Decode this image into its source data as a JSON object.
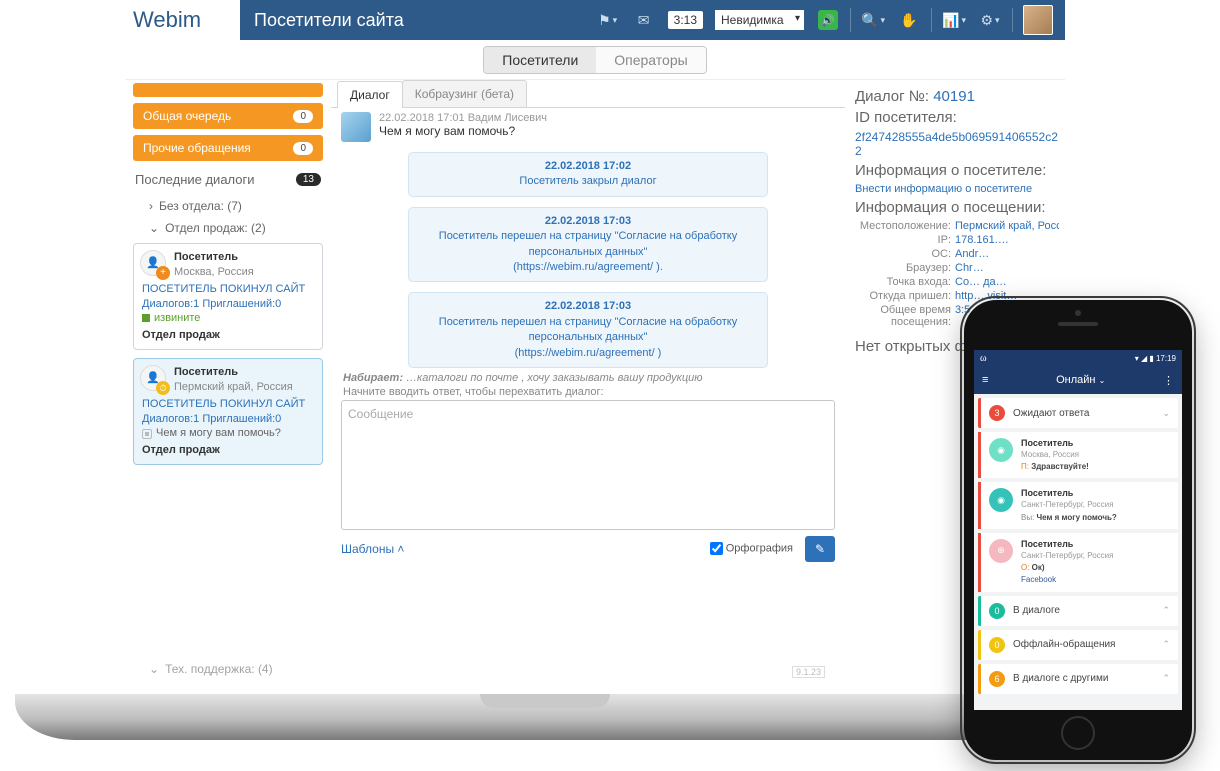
{
  "header": {
    "logo": "Webim",
    "title": "Посетители сайта",
    "timer": "3:13",
    "status_selected": "Невидимка"
  },
  "topseg": {
    "visitors": "Посетители",
    "operators": "Операторы"
  },
  "sidebar": {
    "pill_mine": "",
    "pill_queue": "Общая очередь",
    "pill_queue_badge": "0",
    "pill_other": "Прочие обращения",
    "pill_other_badge": "0",
    "recent_title": "Последние диалоги",
    "recent_badge": "13",
    "dept_none": "Без отдела: (7)",
    "dept_sales": "Отдел продаж: (2)",
    "dept_support": "Тех. поддержка: (4)",
    "card1": {
      "who": "Посетитель",
      "loc": "Москва, Россия",
      "state": "ПОСЕТИТЕЛЬ ПОКИНУЛ САЙТ",
      "stats": "Диалогов:1 Приглашений:0",
      "msg": "извините",
      "dept": "Отдел продаж"
    },
    "card2": {
      "who": "Посетитель",
      "loc": "Пермский край, Россия",
      "state": "ПОСЕТИТЕЛЬ ПОКИНУЛ САЙТ",
      "stats": "Диалогов:1 Приглашений:0",
      "msg": "Чем я могу вам помочь?",
      "dept": "Отдел продаж"
    }
  },
  "chat": {
    "tab_dialog": "Диалог",
    "tab_cobrowse": "Кобраузинг (бета)",
    "op_head": "22.02.2018 17:01   Вадим Лисевич",
    "op_text": "Чем я могу вам помочь?",
    "sys1_ts": "22.02.2018 17:02",
    "sys1_txt": "Посетитель закрыл диалог",
    "sys2_ts": "22.02.2018 17:03",
    "sys2_txt": "Посетитель перешел на страницу \"Согласие на обработку персональных данных\"",
    "sys2_url": "(https://webim.ru/agreement/ ).",
    "sys3_ts": "22.02.2018 17:03",
    "sys3_txt": "Посетитель перешел на страницу \"Согласие на обработку персональных данных\"",
    "sys3_url": "(https://webim.ru/agreement/ )",
    "typing_label": "Набирает:",
    "typing_text": " …каталоги по почте , хочу заказывать вашу продукцию",
    "hint": "Начните вводить ответ, чтобы перехватить диалог:",
    "placeholder": "Сообщение",
    "templates": "Шаблоны",
    "spell": "Орфография",
    "version": "9.1.23"
  },
  "info": {
    "dlg_label": "Диалог №: ",
    "dlg_id": "40191",
    "visitor_label": "ID посетителя:",
    "visitor_id": "2f247428555a4de5b069591406552c22",
    "about_visitor": "Информация о посетителе:",
    "enter_info": "Внести информацию о посетителе",
    "about_visit": "Информация о посещении:",
    "k_loc": "Местоположение:",
    "v_loc": "Пермский край, Россия",
    "k_ip": "IP:",
    "v_ip": "178.161.…",
    "k_os": "ОС:",
    "v_os": "Andr…",
    "k_browser": "Браузер:",
    "v_browser": "Chr…",
    "k_entry": "Точка входа:",
    "v_entry": "Со… да…",
    "k_ref": "Откуда пришел:",
    "v_ref": "http… visit…",
    "k_time": "Общее время посещения:",
    "v_time": "3:5…",
    "no_open": "Нет открытых ф…"
  },
  "phone": {
    "time": "17:19",
    "title": "Онлайн",
    "sec_wait": "Ожидают ответа",
    "sec_wait_n": "3",
    "sec_dlg": "В диалоге",
    "sec_dlg_n": "0",
    "sec_off": "Оффлайн-обращения",
    "sec_off_n": "0",
    "sec_other": "В диалоге с другими",
    "sec_other_n": "6",
    "c1_name": "Посетитель",
    "c1_loc": "Москва, Россия",
    "c1_pre": "П:",
    "c1_msg": " Здравствуйте!",
    "c2_name": "Посетитель",
    "c2_loc": "Санкт-Петербург, Россия",
    "c2_pre": "Вы:",
    "c2_msg": " Чем я могу помочь?",
    "c3_name": "Посетитель",
    "c3_loc": "Санкт-Петербург, Россия",
    "c3_pre": "О:",
    "c3_msg": " Ок)",
    "c3_src": "Facebook"
  }
}
